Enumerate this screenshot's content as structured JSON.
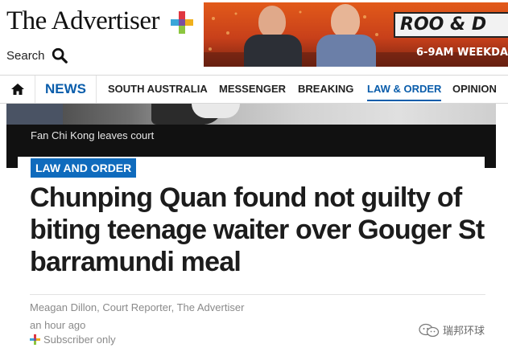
{
  "site": {
    "logo_text": "The Advertiser",
    "search_label": "Search"
  },
  "ad": {
    "title": "ROO & D",
    "subtitle": "6-9AM WEEKDA"
  },
  "nav": {
    "news_label": "NEWS",
    "items": [
      {
        "label": "SOUTH AUSTRALIA",
        "active": false
      },
      {
        "label": "MESSENGER",
        "active": false
      },
      {
        "label": "BREAKING",
        "active": false
      },
      {
        "label": "LAW & ORDER",
        "active": true
      },
      {
        "label": "OPINION",
        "active": false
      }
    ]
  },
  "hero": {
    "caption": "Fan Chi Kong leaves court"
  },
  "article": {
    "category": "LAW AND ORDER",
    "headline": "Chunping Quan found not guilty of biting teenage waiter over Gouger St barramundi meal",
    "byline": "Meagan Dillon, Court Reporter, The Advertiser",
    "time": "an hour ago",
    "access": "Subscriber only"
  },
  "watermark": {
    "text": "瑞邦环球"
  },
  "colors": {
    "brand_blue": "#0a5dab",
    "tag_blue": "#0f6bbd",
    "ad_orange": "#e25a1a"
  }
}
